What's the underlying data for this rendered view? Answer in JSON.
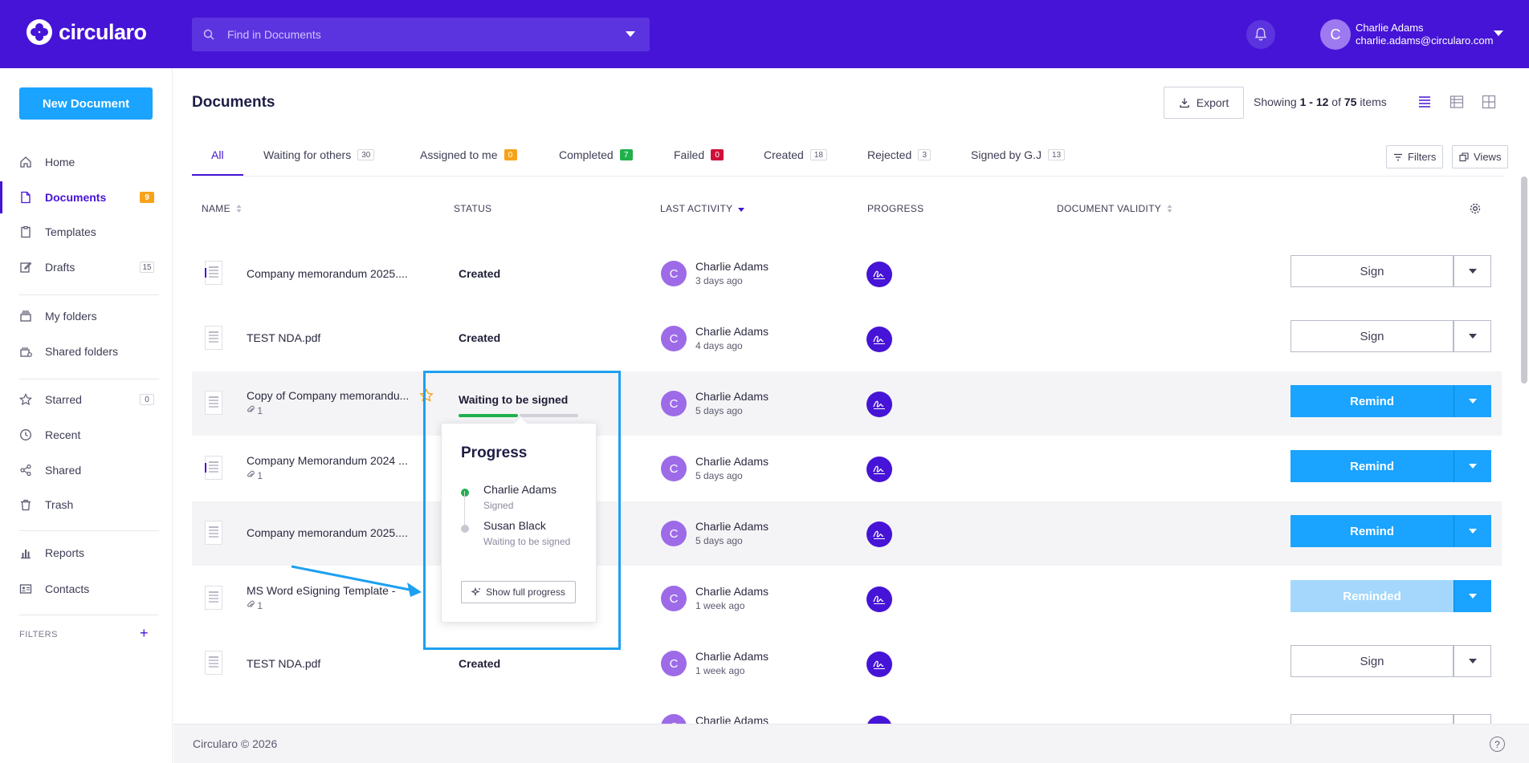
{
  "header": {
    "logo": "circularo",
    "search_placeholder": "Find in Documents",
    "user_initial": "C",
    "user_name": "Charlie Adams",
    "user_email": "charlie.adams@circularo.com"
  },
  "sidebar": {
    "new_document": "New Document",
    "items": [
      {
        "label": "Home",
        "icon": "home-icon"
      },
      {
        "label": "Documents",
        "icon": "document-icon",
        "badge": "9"
      },
      {
        "label": "Templates",
        "icon": "clipboard-icon"
      },
      {
        "label": "Drafts",
        "icon": "pencil-icon",
        "badge": "15"
      },
      {
        "label": "My folders",
        "icon": "folder-stack-icon"
      },
      {
        "label": "Shared folders",
        "icon": "shared-folder-icon"
      },
      {
        "label": "Starred",
        "icon": "star-icon",
        "badge": "0"
      },
      {
        "label": "Recent",
        "icon": "clock-icon"
      },
      {
        "label": "Shared",
        "icon": "share-icon"
      },
      {
        "label": "Trash",
        "icon": "trash-icon"
      },
      {
        "label": "Reports",
        "icon": "bar-chart-icon"
      },
      {
        "label": "Contacts",
        "icon": "contact-card-icon"
      }
    ],
    "filters_label": "FILTERS",
    "filters_add": "+"
  },
  "main": {
    "title": "Documents",
    "export_label": "Export",
    "showing_prefix": "Showing",
    "showing_range": "1 - 12",
    "showing_of": "of",
    "showing_total": "75",
    "showing_suffix": "items",
    "tabs": [
      {
        "label": "All"
      },
      {
        "label": "Waiting for others",
        "count": "30"
      },
      {
        "label": "Assigned to me",
        "count": "0"
      },
      {
        "label": "Completed",
        "count": "7"
      },
      {
        "label": "Failed",
        "count": "0"
      },
      {
        "label": "Created",
        "count": "18"
      },
      {
        "label": "Rejected",
        "count": "3"
      },
      {
        "label": "Signed by G.J",
        "count": "13"
      }
    ],
    "filters_button": "Filters",
    "views_button": "Views",
    "columns": {
      "name": "NAME",
      "status": "STATUS",
      "last_activity": "LAST ACTIVITY",
      "progress": "PROGRESS",
      "validity": "DOCUMENT VALIDITY"
    },
    "rows": [
      {
        "name": "Company memorandum 2025....",
        "attachments": "",
        "status": "Created",
        "user": "Charlie Adams",
        "initial": "C",
        "time": "3 days ago",
        "action": "Sign"
      },
      {
        "name": "TEST NDA.pdf",
        "attachments": "",
        "status": "Created",
        "user": "Charlie Adams",
        "initial": "C",
        "time": "4 days ago",
        "action": "Sign"
      },
      {
        "name": "Copy of Company memorandu...",
        "attachments": "1",
        "status": "Waiting to be signed",
        "user": "Charlie Adams",
        "initial": "C",
        "time": "5 days ago",
        "action": "Remind"
      },
      {
        "name": "Company Memorandum 2024 ...",
        "attachments": "1",
        "status": "",
        "user": "Charlie Adams",
        "initial": "C",
        "time": "5 days ago",
        "action": "Remind"
      },
      {
        "name": "Company memorandum 2025....",
        "attachments": "",
        "status": "",
        "user": "Charlie Adams",
        "initial": "C",
        "time": "5 days ago",
        "action": "Remind"
      },
      {
        "name": "MS Word eSigning Template -",
        "attachments": "1",
        "status": "",
        "user": "Charlie Adams",
        "initial": "C",
        "time": "1 week ago",
        "action": "Reminded"
      },
      {
        "name": "TEST NDA.pdf",
        "attachments": "",
        "status": "Created",
        "user": "Charlie Adams",
        "initial": "C",
        "time": "1 week ago",
        "action": "Sign"
      },
      {
        "name": "",
        "attachments": "",
        "status": "",
        "user": "Charlie Adams",
        "initial": "C",
        "time": "",
        "action": ""
      }
    ]
  },
  "popover": {
    "title": "Progress",
    "signers": [
      {
        "name": "Charlie Adams",
        "state": "Signed"
      },
      {
        "name": "Susan Black",
        "state": "Waiting to be signed"
      }
    ],
    "button": "Show full progress",
    "signing_progress": 0.5
  },
  "footer": {
    "copyright": "Circularo © 2026",
    "help": "?"
  },
  "colors": {
    "brand": "#4614d6",
    "accent": "#1aa3ff",
    "success": "#21b04b",
    "danger": "#d0103a",
    "warning": "#f7a21b",
    "highlight": "#1ea0f0"
  }
}
